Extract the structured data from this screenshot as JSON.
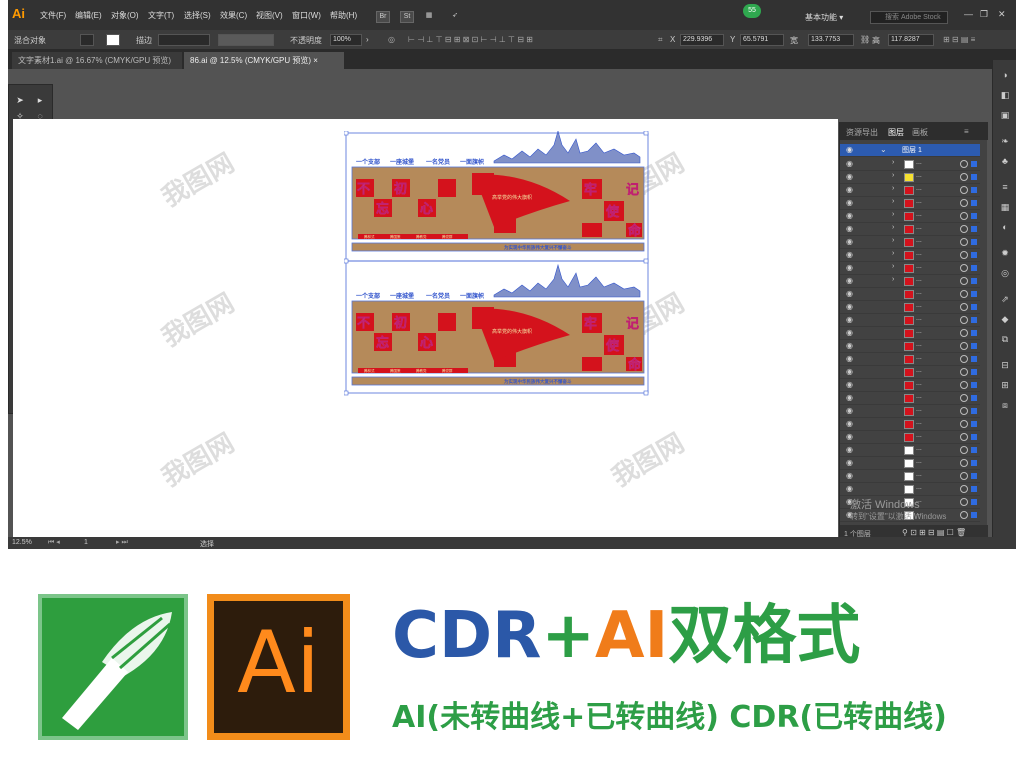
{
  "app": {
    "logo": "Ai",
    "menu": [
      "文件(F)",
      "编辑(E)",
      "对象(O)",
      "文字(T)",
      "选择(S)",
      "效果(C)",
      "视图(V)",
      "窗口(W)",
      "帮助(H)"
    ],
    "bridge_btn": "Br",
    "stock_btn": "St",
    "badge": "55",
    "workspace": "基本功能",
    "search_placeholder": "搜索 Adobe Stock"
  },
  "control": {
    "selection": "混合对象",
    "stroke_label": "描边",
    "opacity_label": "不透明度",
    "opacity_value": "100%",
    "x_label": "X",
    "x_value": "229.9396",
    "y_label": "Y",
    "y_value": "65.5791",
    "w_label": "宽",
    "w_value": "133.7753",
    "h_label": "高",
    "h_value": "117.8287"
  },
  "tabs": [
    {
      "label": "文字素材1.ai @ 16.67% (CMYK/GPU 预览)",
      "active": false
    },
    {
      "label": "86.ai @ 12.5% (CMYK/GPU 预览)",
      "active": true
    }
  ],
  "artwork": {
    "slogans": [
      "一个支部",
      "一座城堡",
      "一名党员",
      "一面旗帜"
    ],
    "left_chars": [
      "不",
      "初",
      "忘",
      "心"
    ],
    "right_chars": [
      "牢",
      "记",
      "使",
      "命"
    ],
    "flag_text": "高举党的伟大旗帜",
    "bottom_left_items": [
      "腾林式",
      "腾国策",
      "腾教党",
      "腾党群"
    ],
    "bottom_right_text": "为实现中华民族伟大复兴不懈奋斗"
  },
  "layers": {
    "tabs": [
      "资源导出",
      "图层",
      "画板"
    ],
    "layer_name": "图层 1",
    "footer": "1 个图层"
  },
  "status": {
    "zoom": "12.5%",
    "page": "1",
    "mode": "选择"
  },
  "watermark": {
    "text": "我图网",
    "activate": "激活 Windows",
    "activate_hint": "转到\"设置\"以激活 Windows"
  },
  "banner": {
    "cdr": "CDR",
    "plus": "+",
    "ai": "AI",
    "fmt": "双格式",
    "sub_a": "AI(未转曲线+已转曲线)",
    "sub_b": "CDR(已转曲线)",
    "ai_logo": "Ai"
  },
  "colors": {
    "brand_blue": "#2b58a8",
    "brand_orange": "#f07c1a",
    "brand_green": "#2d9e46",
    "party_red": "#d4121c",
    "wood": "#b58a5a"
  }
}
